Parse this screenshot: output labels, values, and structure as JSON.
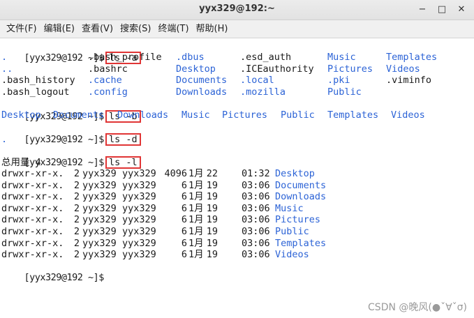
{
  "window": {
    "title": "yyx329@192:~",
    "minimize_label": "−",
    "maximize_label": "□",
    "close_label": "✕"
  },
  "menu": [
    "文件(F)",
    "编辑(E)",
    "查看(V)",
    "搜索(S)",
    "终端(T)",
    "帮助(H)"
  ],
  "prompt": "[yyx329@192 ~]$",
  "commands": {
    "a": "ls -a",
    "b": "ls -b",
    "d": "ls -d",
    "l": "ls -l"
  },
  "ls_a": {
    "rows": [
      [
        ".",
        ".bash_profile",
        ".dbus",
        ".esd_auth",
        "Music",
        "Templates"
      ],
      [
        "..",
        ".bashrc",
        "Desktop",
        ".ICEauthority",
        "Pictures",
        "Videos"
      ],
      [
        ".bash_history",
        ".cache",
        "Documents",
        ".local",
        ".pki",
        ".viminfo"
      ],
      [
        ".bash_logout",
        ".config",
        "Downloads",
        ".mozilla",
        "Public",
        ""
      ]
    ],
    "dir_flags": [
      [
        true,
        false,
        true,
        false,
        true,
        true
      ],
      [
        true,
        false,
        true,
        false,
        true,
        true
      ],
      [
        false,
        true,
        true,
        true,
        true,
        false
      ],
      [
        false,
        true,
        true,
        true,
        true,
        false
      ]
    ]
  },
  "ls_b": [
    "Desktop",
    "Documents",
    "Downloads",
    "Music",
    "Pictures",
    "Public",
    "Templates",
    "Videos"
  ],
  "ls_d": ".",
  "ls_l": {
    "total": "总用量 4",
    "rows": [
      {
        "perm": "drwxr-xr-x.",
        "links": "2",
        "user": "yyx329",
        "group": "yyx329",
        "size": "4096",
        "month": "1月",
        "day": "22",
        "time": "01:32",
        "name": "Desktop"
      },
      {
        "perm": "drwxr-xr-x.",
        "links": "2",
        "user": "yyx329",
        "group": "yyx329",
        "size": "6",
        "month": "1月",
        "day": "19",
        "time": "03:06",
        "name": "Documents"
      },
      {
        "perm": "drwxr-xr-x.",
        "links": "2",
        "user": "yyx329",
        "group": "yyx329",
        "size": "6",
        "month": "1月",
        "day": "19",
        "time": "03:06",
        "name": "Downloads"
      },
      {
        "perm": "drwxr-xr-x.",
        "links": "2",
        "user": "yyx329",
        "group": "yyx329",
        "size": "6",
        "month": "1月",
        "day": "19",
        "time": "03:06",
        "name": "Music"
      },
      {
        "perm": "drwxr-xr-x.",
        "links": "2",
        "user": "yyx329",
        "group": "yyx329",
        "size": "6",
        "month": "1月",
        "day": "19",
        "time": "03:06",
        "name": "Pictures"
      },
      {
        "perm": "drwxr-xr-x.",
        "links": "2",
        "user": "yyx329",
        "group": "yyx329",
        "size": "6",
        "month": "1月",
        "day": "19",
        "time": "03:06",
        "name": "Public"
      },
      {
        "perm": "drwxr-xr-x.",
        "links": "2",
        "user": "yyx329",
        "group": "yyx329",
        "size": "6",
        "month": "1月",
        "day": "19",
        "time": "03:06",
        "name": "Templates"
      },
      {
        "perm": "drwxr-xr-x.",
        "links": "2",
        "user": "yyx329",
        "group": "yyx329",
        "size": "6",
        "month": "1月",
        "day": "19",
        "time": "03:06",
        "name": "Videos"
      }
    ]
  },
  "watermark": "CSDN @晚风(●ˇ∀ˇσ)",
  "colors": {
    "directory": "#2c63d6",
    "highlight_box": "#e03535",
    "text": "#1a1a1a",
    "background": "#ffffff"
  }
}
